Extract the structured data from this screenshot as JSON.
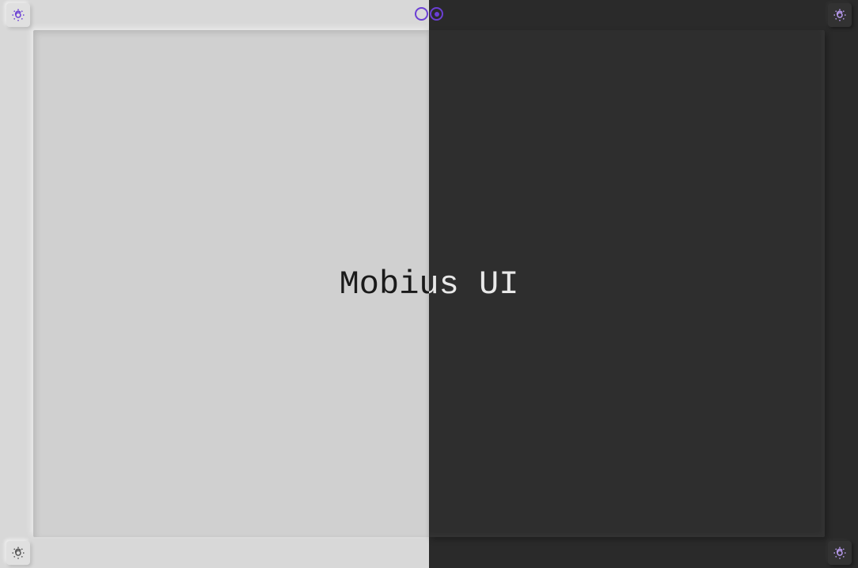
{
  "title": "Mobius UI",
  "accentColor": "#6b3fd4",
  "buttons": {
    "topLeft": {
      "icon": "sun-moon",
      "theme": "light"
    },
    "topRight": {
      "icon": "sun-moon",
      "theme": "dark"
    },
    "bottomLeft": {
      "icon": "sun-moon",
      "theme": "light"
    },
    "bottomRight": {
      "icon": "sun-moon",
      "theme": "dark"
    }
  },
  "indicators": {
    "left": {
      "filled": false
    },
    "right": {
      "filled": true
    }
  }
}
